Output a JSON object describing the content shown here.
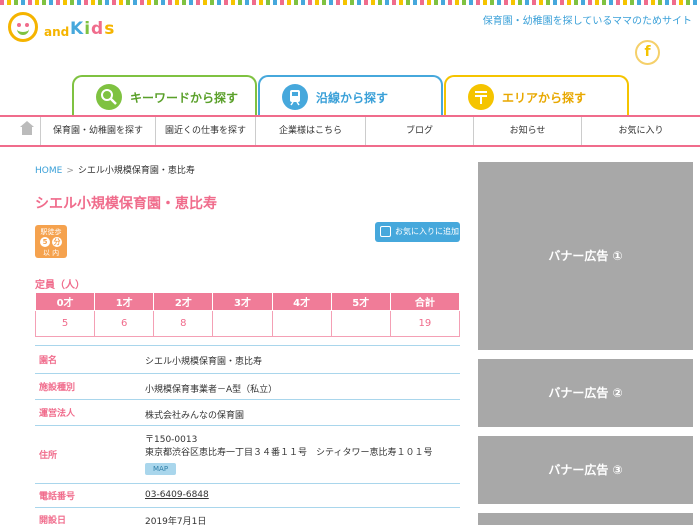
{
  "logo": {
    "word_and": "and",
    "word_kids": [
      "K",
      "i",
      "d",
      "s"
    ]
  },
  "header": {
    "tagline": "保育園・幼稚園を探しているママのためサイト",
    "facebook_glyph": "f"
  },
  "search_tabs": [
    {
      "label": "キーワードから探す",
      "icon": "search-icon"
    },
    {
      "label": "沿線から探す",
      "icon": "train-icon"
    },
    {
      "label": "エリアから探す",
      "icon": "map-pin-icon"
    }
  ],
  "nav": {
    "items": [
      "保育園・幼稚園を探す",
      "園近くの仕事を探す",
      "企業様はこちら",
      "ブログ",
      "お知らせ",
      "お気に入り"
    ]
  },
  "breadcrumb": {
    "home": "HOME",
    "separator": ">",
    "current": "シエル小規模保育園・恵比寿"
  },
  "facility": {
    "name": "シエル小規模保育園・恵比寿",
    "walk_badge": {
      "top": "駅徒歩",
      "digit1": "5",
      "digit2": "分",
      "bottom": "以 内"
    },
    "favorite_button": "お気に入りに追加"
  },
  "capacity": {
    "label": "定員（人）",
    "headers": [
      "0才",
      "1才",
      "2才",
      "3才",
      "4才",
      "5才",
      "合計"
    ],
    "values": [
      "5",
      "6",
      "8",
      "",
      "",
      "",
      "19"
    ]
  },
  "info": {
    "rows": [
      {
        "label": "園名",
        "value": "シエル小規模保育園・恵比寿"
      },
      {
        "label": "施設種別",
        "value": "小規模保育事業者－A型（私立）"
      },
      {
        "label": "運営法人",
        "value": "株式会社みんなの保育園"
      },
      {
        "label": "住所",
        "postal": "〒150-0013",
        "value": "東京都渋谷区恵比寿一丁目３４番１１号　シティタワー恵比寿１０１号",
        "map_button": "MAP"
      },
      {
        "label": "電話番号",
        "value": "03-6409-6848"
      },
      {
        "label": "開設日",
        "value": "2019年7月1日"
      }
    ]
  },
  "banners": [
    "バナー広告 ①",
    "バナー広告 ②",
    "バナー広告 ③"
  ],
  "colors": {
    "pink": "#f06c8c",
    "green": "#7fc241",
    "blue": "#46a8dc",
    "yellow": "#f5c400",
    "banner_gray": "#a8a8a8"
  }
}
